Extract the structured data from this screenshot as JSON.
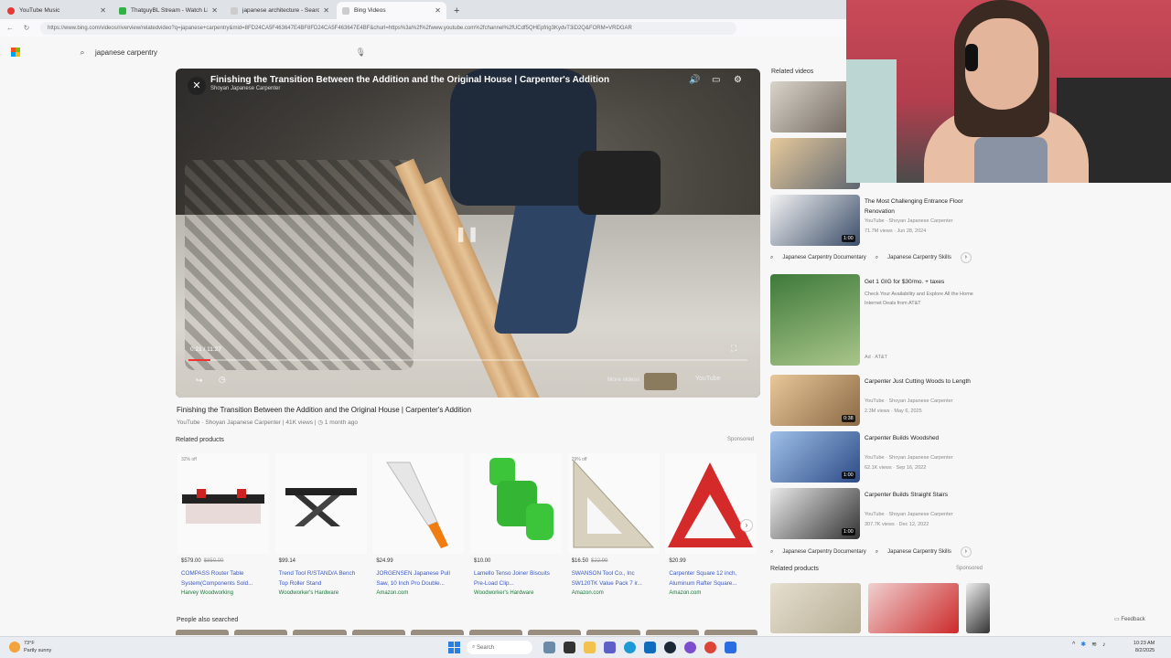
{
  "tabs": [
    {
      "label": "YouTube Music",
      "color": "#e53935",
      "active": false
    },
    {
      "label": "ThatguyBL Stream - Watch Live o",
      "color": "#2fb344",
      "active": false
    },
    {
      "label": "japanese architecture - Search",
      "color": "#cccccc",
      "active": false
    },
    {
      "label": "Bing Videos",
      "color": "#cccccc",
      "active": true
    }
  ],
  "address_bar": {
    "url": "https://www.bing.com/videos/riverview/relatedvideo?q=japanese+carpentry&mid=8FD24CA5F463647E4BF8FD24CA5F463647E4BF&churl=https%3a%2f%2fwww.youtube.com%2fchannel%2fUCdf5QHEpfrig3KydvT3iD2Q&FORM=VRDGAR"
  },
  "search": {
    "query": "japanese carpentry"
  },
  "video": {
    "title": "Finishing the Transition Between the Addition and the Original House | Carpenter's Addition",
    "channel": "Shoyan Japanese Carpenter",
    "time": "0:21 / 11:27",
    "progress": 0.04,
    "more_videos": "More videos",
    "yt_logo": "YouTube",
    "meta_source": "YouTube",
    "meta_channel": "Shoyan Japanese Carpenter",
    "meta_views": "41K views",
    "meta_age": "1 month ago"
  },
  "related_products": {
    "title": "Related products",
    "sponsored": "Sponsored",
    "items": [
      {
        "badge": "32% off",
        "price": "$579.00",
        "old_price": "$850.00",
        "name": "COMPASS Router Table System(Components Sold...",
        "store": "Harvey Woodworking",
        "kind": "router"
      },
      {
        "badge": "",
        "price": "$99.14",
        "old_price": "",
        "name": "Trend Tool R/STAND/A Bench Top Roller Stand",
        "store": "Woodworker's Hardware",
        "kind": "stand"
      },
      {
        "badge": "",
        "price": "$24.99",
        "old_price": "",
        "name": "JORGENSEN Japanese Pull Saw, 10 Inch Pro Double...",
        "store": "Amazon.com",
        "kind": "saw"
      },
      {
        "badge": "",
        "price": "$10.00",
        "old_price": "",
        "name": "Lamello Tenso Joiner Biscuits Pre-Load Clip...",
        "store": "Woodworker's Hardware",
        "kind": "clip"
      },
      {
        "badge": "29% off",
        "price": "$16.50",
        "old_price": "$22.99",
        "name": "SWANSON Tool Co., Inc SW120TK Value Pack 7 ir...",
        "store": "Amazon.com",
        "kind": "square"
      },
      {
        "badge": "",
        "price": "$20.99",
        "old_price": "",
        "name": "Carpenter Square 12 inch, Aluminum Rafter Square...",
        "store": "Amazon.com",
        "kind": "redsquare"
      }
    ]
  },
  "people_also_searched": "People also searched",
  "related_videos": {
    "title": "Related videos",
    "items": [
      {
        "title": "",
        "m1": "",
        "m2": "",
        "duration": ""
      },
      {
        "title": "",
        "m1": "",
        "m2": "",
        "duration": ""
      },
      {
        "title": "The Most Challenging Entrance Floor Renovation",
        "m1": "YouTube · Shoyan Japanese Carpenter",
        "m2": "71.7M views · Jun 28, 2024",
        "duration": "1:00"
      },
      {
        "title": "Carpenter Just Cutting Woods to Length",
        "m1": "YouTube · Shoyan Japanese Carpenter",
        "m2": "2.3M views · May 6, 2025",
        "duration": "0:38"
      },
      {
        "title": "Carpenter Builds Woodshed",
        "m1": "YouTube · Shoyan Japanese Carpenter",
        "m2": "62.1K views · Sep 16, 2022",
        "duration": "1:00"
      },
      {
        "title": "Carpenter Builds Straight Stairs",
        "m1": "YouTube · Shoyan Japanese Carpenter",
        "m2": "307.7K views · Dec 12, 2022",
        "duration": "1:00"
      }
    ],
    "chips": [
      "Japanese Carpentry Documentary",
      "Japanese Carpentry Skills"
    ]
  },
  "ad": {
    "title": "Get 1 GIG for $30/mo. + taxes",
    "desc": "Check Your Availability and Explore All the Home Internet Deals from AT&T",
    "source": "Ad · AT&T"
  },
  "right_products_title": "Related products",
  "feedback": "Feedback",
  "taskbar": {
    "weather_temp": "73°F",
    "weather_desc": "Partly sunny",
    "search": "Search",
    "time": "10:23 AM",
    "date": "8/2/2025"
  }
}
